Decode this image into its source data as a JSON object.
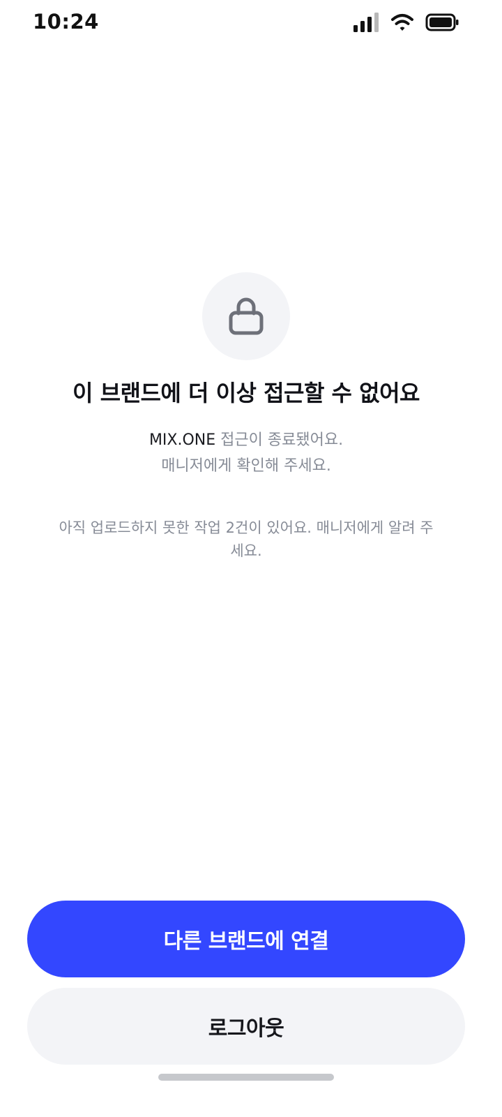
{
  "status_bar": {
    "time": "10:24",
    "icons": [
      "signal-icon",
      "wifi-icon",
      "battery-icon"
    ]
  },
  "lock": {
    "icon": "lock-icon"
  },
  "title": "이 브랜드에 더 이상 접근할 수 없어요",
  "subtitle": {
    "brand": "MIX.ONE",
    "line1_rest": " 접근이 종료됐어요.",
    "line2": "매니저에게 확인해 주세요."
  },
  "notice": "아직 업로드하지 못한 작업 2건이 있어요. 매니저에게 알려 주세요.",
  "actions": {
    "connect_label": "다른 브랜드에 연결",
    "logout_label": "로그아웃"
  },
  "colors": {
    "primary": "#3347ff",
    "secondary_bg": "#f3f4f7",
    "muted_text": "#868b96"
  }
}
